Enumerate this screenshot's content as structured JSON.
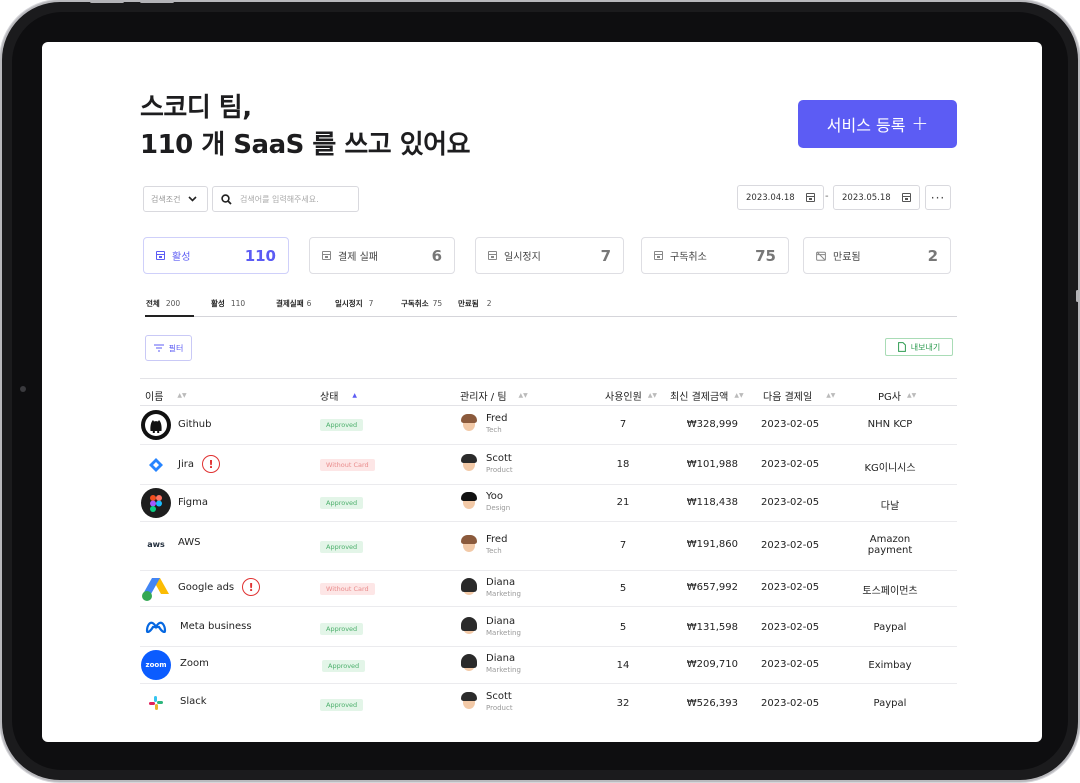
{
  "header": {
    "title_line1": "스코디 팀,",
    "title_line2": "110 개 SaaS 를 쓰고 있어요",
    "register_button": "서비스 등록",
    "register_plus": "+"
  },
  "toolbar": {
    "search_condition": "검색조건",
    "search_placeholder": "검색어를 입력해주세요.",
    "date_from": "2023.04.18",
    "date_to": "2023.05.18",
    "date_separator": "-",
    "more": "···"
  },
  "stats": [
    {
      "label": "활성",
      "value": "110"
    },
    {
      "label": "결제 실패",
      "value": "6"
    },
    {
      "label": "일시정지",
      "value": "7"
    },
    {
      "label": "구독취소",
      "value": "75"
    },
    {
      "label": "만료됨",
      "value": "2"
    }
  ],
  "tabs": [
    {
      "label": "전체",
      "count": "200"
    },
    {
      "label": "활성",
      "count": "110"
    },
    {
      "label": "결제실패",
      "count": "6"
    },
    {
      "label": "일시정지",
      "count": "7"
    },
    {
      "label": "구독취소",
      "count": "75"
    },
    {
      "label": "만료됨",
      "count": "2"
    }
  ],
  "actions": {
    "filter": "필터",
    "export": "내보내기"
  },
  "table": {
    "columns": [
      "이름",
      "상태",
      "관리자 / 팀",
      "사용인원",
      "최신 결제금액",
      "다음 결제일",
      "PG사"
    ],
    "rows": [
      {
        "name": "Github",
        "warning": false,
        "status": "Approved",
        "manager": "Fred",
        "team": "Tech",
        "users": "7",
        "amount": "₩328,999",
        "next_date": "2023-02-05",
        "pg": "NHN KCP"
      },
      {
        "name": "Jira",
        "warning": true,
        "status": "Without Card",
        "manager": "Scott",
        "team": "Product",
        "users": "18",
        "amount": "₩101,988",
        "next_date": "2023-02-05",
        "pg": "KG이니시스"
      },
      {
        "name": "Figma",
        "warning": false,
        "status": "Approved",
        "manager": "Yoo",
        "team": "Design",
        "users": "21",
        "amount": "₩118,438",
        "next_date": "2023-02-05",
        "pg": "다날"
      },
      {
        "name": "AWS",
        "warning": false,
        "status": "Approved",
        "manager": "Fred",
        "team": "Tech",
        "users": "7",
        "amount": "₩191,860",
        "next_date": "2023-02-05",
        "pg": "Amazon payment"
      },
      {
        "name": "Google ads",
        "warning": true,
        "status": "Without Card",
        "manager": "Diana",
        "team": "Marketing",
        "users": "5",
        "amount": "₩657,992",
        "next_date": "2023-02-05",
        "pg": "토스페이먼츠"
      },
      {
        "name": "Meta business",
        "warning": false,
        "status": "Approved",
        "manager": "Diana",
        "team": "Marketing",
        "users": "5",
        "amount": "₩131,598",
        "next_date": "2023-02-05",
        "pg": "Paypal"
      },
      {
        "name": "Zoom",
        "warning": false,
        "status": "Approved",
        "manager": "Diana",
        "team": "Marketing",
        "users": "14",
        "amount": "₩209,710",
        "next_date": "2023-02-05",
        "pg": "Eximbay"
      },
      {
        "name": "Slack",
        "warning": false,
        "status": "Approved",
        "manager": "Scott",
        "team": "Product",
        "users": "32",
        "amount": "₩526,393",
        "next_date": "2023-02-05",
        "pg": "Paypal"
      }
    ]
  },
  "logos": {
    "aws_text": "aws",
    "zoom_text": "zoom",
    "warning_glyph": "!"
  },
  "colors": {
    "accent": "#5c5cf4",
    "approved_bg": "#e3f5e8",
    "approved_text": "#4caf6b",
    "nocard_bg": "#fde6e6",
    "nocard_text": "#e98c8c",
    "warning": "#e03131",
    "export_green": "#2f9c52"
  }
}
